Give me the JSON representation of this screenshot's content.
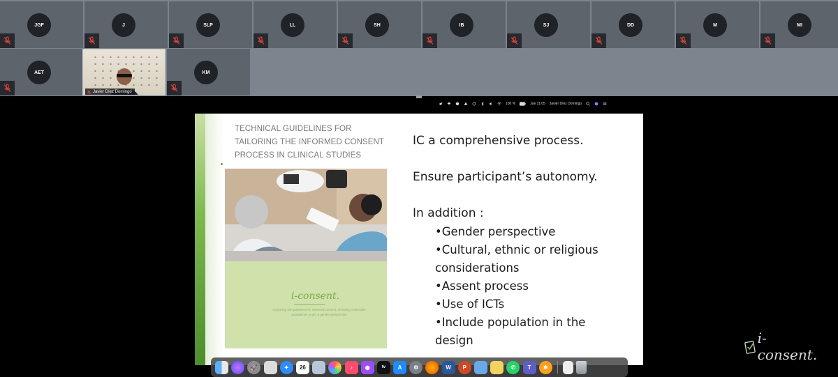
{
  "participants": [
    {
      "initials": "JGF"
    },
    {
      "initials": "J"
    },
    {
      "initials": "SLP"
    },
    {
      "initials": "LL"
    },
    {
      "initials": "SH"
    },
    {
      "initials": "IB"
    },
    {
      "initials": "SJ"
    },
    {
      "initials": "DD"
    },
    {
      "initials": "M"
    },
    {
      "initials": "MI"
    },
    {
      "initials": "AET"
    },
    {
      "initials": "KM"
    }
  ],
  "video_participant": {
    "name": "Javier Díez Domingo"
  },
  "menubar": {
    "battery": "100 %",
    "clock": "Jue 11:05",
    "user": "Javier Díez Domingo"
  },
  "slide": {
    "book_title": "TECHNICAL GUIDELINES FOR TAILORING THE INFORMED CONSENT PROCESS IN CLINICAL STUDIES",
    "cover_logo": "i-consent.",
    "cover_subtitle": "Improving the guidelines for informed consent, including vulnerable populations under a gender perspective",
    "line1": "IC a comprehensive process.",
    "line2": "Ensure participant’s autonomy.",
    "line3": "In addition :",
    "bullets": [
      "•Gender perspective",
      "•Cultural, ethnic or religious considerations",
      "•Assent process",
      "•Use of ICTs",
      "•Include population in the design"
    ]
  },
  "dock": {
    "calendar_day": "26",
    "icons": [
      "finder-icon",
      "siri-icon",
      "launchpad-icon",
      "photos-browser-icon",
      "safari-icon",
      "calendar-icon",
      "preview-icon",
      "photos-icon",
      "music-icon",
      "podcasts-icon",
      "apple-tv-icon",
      "app-store-icon",
      "system-preferences-icon",
      "firefox-icon",
      "word-icon",
      "powerpoint-icon",
      "finder-folder-icon",
      "stickies-icon",
      "whatsapp-icon",
      "teams-icon",
      "snowflake-icon",
      "document-icon",
      "trash-icon"
    ]
  },
  "brand": {
    "logo_text": "i-consent."
  },
  "colors": {
    "gallery_bg": "#7d848e",
    "tile_bg": "#5d646c",
    "avatar_bg": "#1f2226",
    "mute_red": "#e0443d",
    "slide_green": "#7fb94f"
  }
}
